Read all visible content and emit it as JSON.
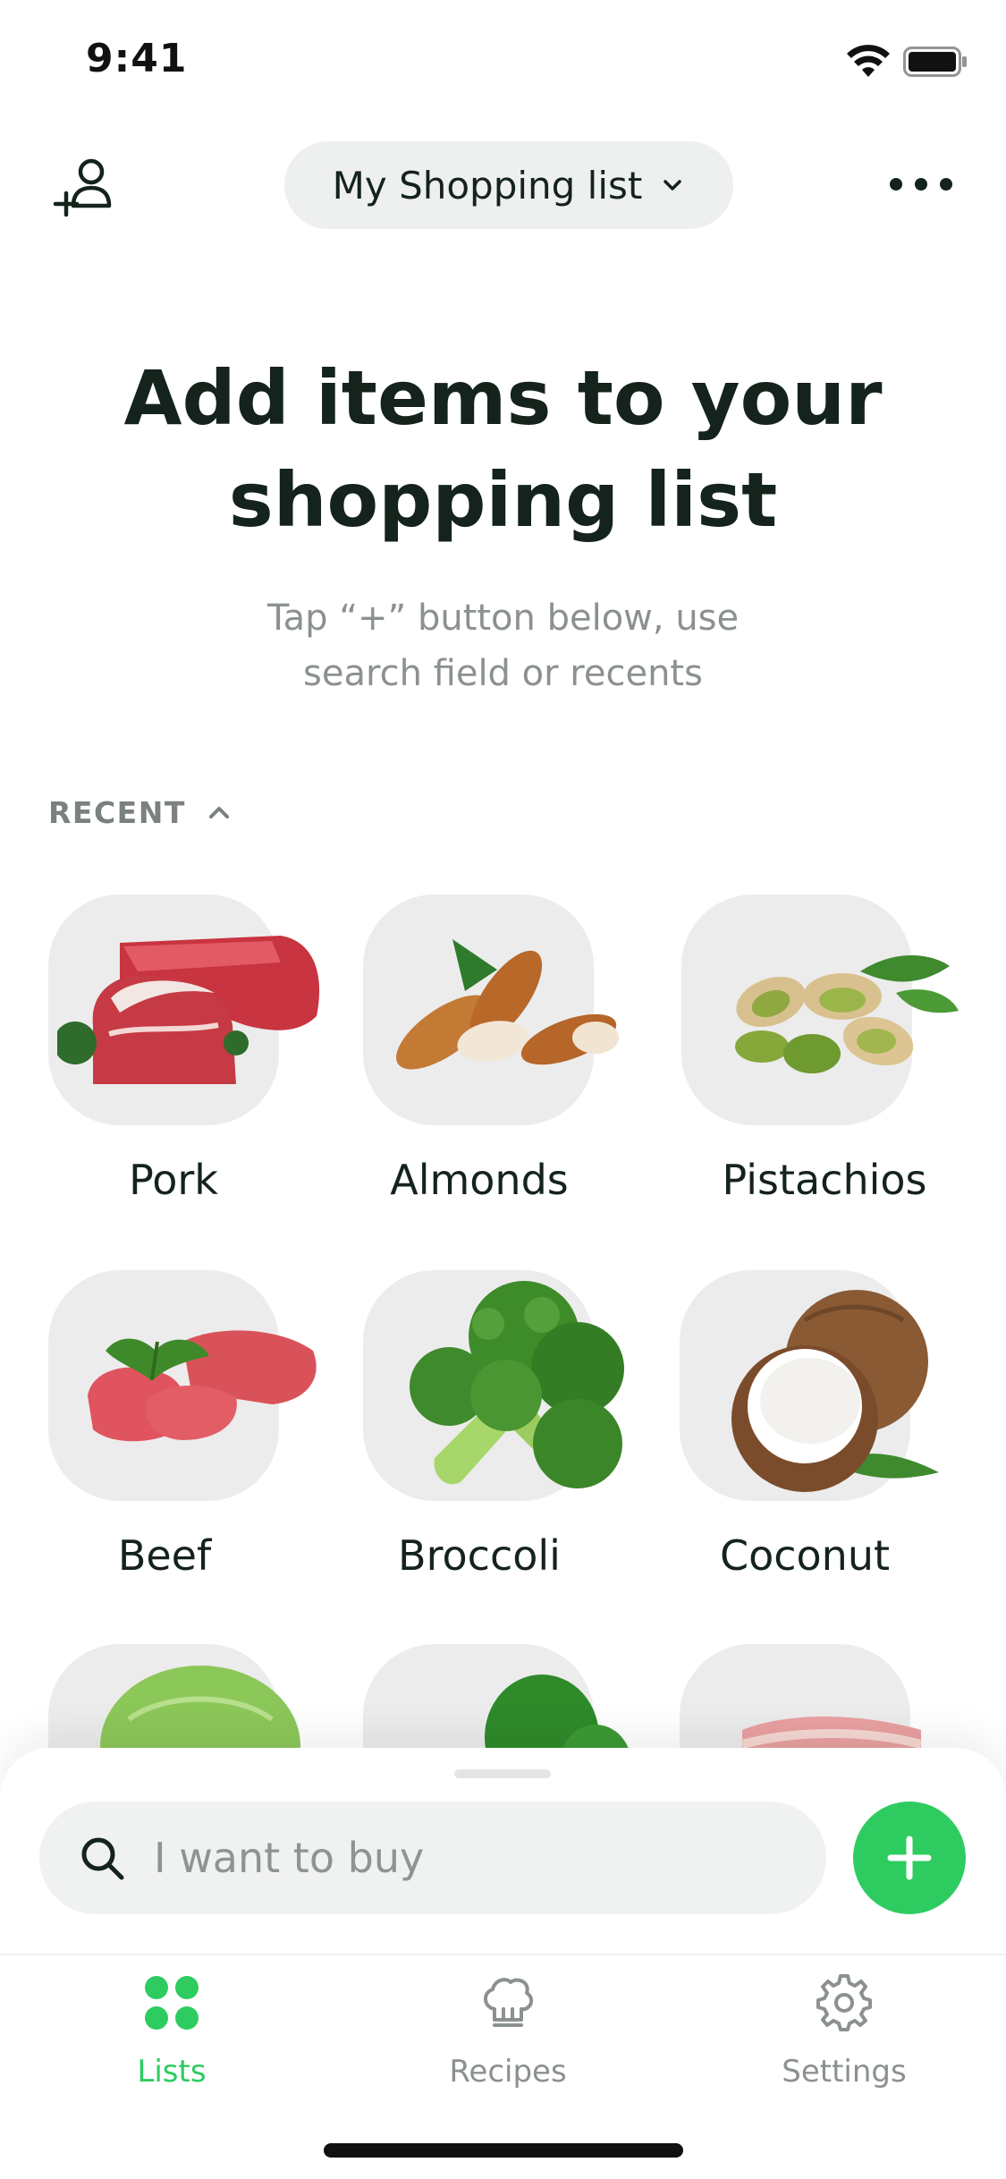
{
  "status_bar": {
    "time": "9:41"
  },
  "header": {
    "list_name": "My Shopping list"
  },
  "empty_state": {
    "title": "Add items to your shopping list",
    "subtitle": "Tap “+” button below, use search field or recents"
  },
  "recent": {
    "label": "RECENT",
    "items": [
      {
        "label": "Pork"
      },
      {
        "label": "Almonds"
      },
      {
        "label": "Pistachios"
      },
      {
        "label": "Beef"
      },
      {
        "label": "Broccoli"
      },
      {
        "label": "Coconut"
      }
    ]
  },
  "search": {
    "placeholder": "I want to buy"
  },
  "tabs": [
    {
      "label": "Lists",
      "icon": "grid-icon",
      "active": true
    },
    {
      "label": "Recipes",
      "icon": "chef-hat-icon",
      "active": false
    },
    {
      "label": "Settings",
      "icon": "gear-icon",
      "active": false
    }
  ],
  "colors": {
    "accent": "#2ECC60",
    "text": "#14231B",
    "muted": "#8B918E",
    "tile": "#ECECEC"
  }
}
